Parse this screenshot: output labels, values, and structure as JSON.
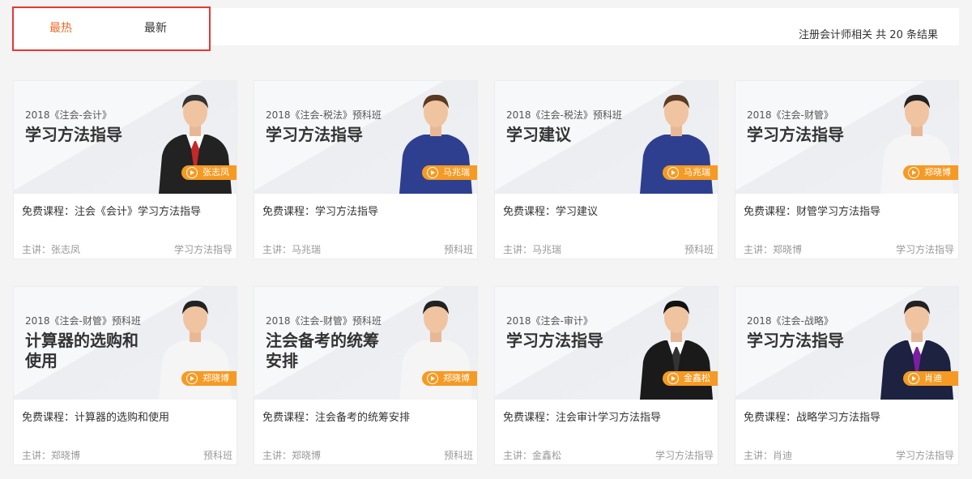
{
  "tabs": [
    {
      "label": "最热",
      "active": true
    },
    {
      "label": "最新",
      "active": false
    }
  ],
  "result_summary": "注册会计师相关 共 20 条结果",
  "colors": {
    "accent": "#f06a2a",
    "tag": "#f59a23",
    "highlight_border": "#e53935"
  },
  "courses": [
    {
      "subtitle": "2018《注会-会计》",
      "headline": "学习方法指导",
      "teacher_tag": "张志凤",
      "title": "免费课程：注会《会计》学习方法指导",
      "lecturer": "主讲：张志凤",
      "category": "学习方法指导",
      "suit": "#222",
      "shirt": "#fff",
      "tie": "#c62828",
      "hair": "#333"
    },
    {
      "subtitle": "2018《注会-税法》预科班",
      "headline": "学习方法指导",
      "teacher_tag": "马兆瑞",
      "title": "免费课程：学习方法指导",
      "lecturer": "主讲：马兆瑞",
      "category": "预科班",
      "suit": "#2e3f8f",
      "shirt": "#2e3f8f",
      "tie": "",
      "hair": "#5a3a22"
    },
    {
      "subtitle": "2018《注会-税法》预科班",
      "headline": "学习建议",
      "teacher_tag": "马兆瑞",
      "title": "免费课程：学习建议",
      "lecturer": "主讲：马兆瑞",
      "category": "预科班",
      "suit": "#2e3f8f",
      "shirt": "#2e3f8f",
      "tie": "",
      "hair": "#5a3a22"
    },
    {
      "subtitle": "2018《注会-财管》",
      "headline": "学习方法指导",
      "teacher_tag": "郑晓博",
      "title": "免费课程：财管学习方法指导",
      "lecturer": "主讲：郑晓博",
      "category": "学习方法指导",
      "suit": "#f5f5f5",
      "shirt": "#f5f5f5",
      "tie": "",
      "hair": "#222"
    },
    {
      "subtitle": "2018《注会-财管》预科班",
      "headline": "计算器的选购和使用",
      "teacher_tag": "郑晓博",
      "title": "免费课程：计算器的选购和使用",
      "lecturer": "主讲：郑晓博",
      "category": "预科班",
      "suit": "#f5f5f5",
      "shirt": "#f5f5f5",
      "tie": "",
      "hair": "#222"
    },
    {
      "subtitle": "2018《注会-财管》预科班",
      "headline": "注会备考的统筹安排",
      "teacher_tag": "郑晓博",
      "title": "免费课程：注会备考的统筹安排",
      "lecturer": "主讲：郑晓博",
      "category": "预科班",
      "suit": "#f5f5f5",
      "shirt": "#f5f5f5",
      "tie": "",
      "hair": "#222"
    },
    {
      "subtitle": "2018《注会-审计》",
      "headline": "学习方法指导",
      "teacher_tag": "金鑫松",
      "title": "免费课程：注会审计学习方法指导",
      "lecturer": "主讲：金鑫松",
      "category": "学习方法指导",
      "suit": "#1a1a1a",
      "shirt": "#fff",
      "tie": "#333",
      "hair": "#111"
    },
    {
      "subtitle": "2018《注会-战略》",
      "headline": "学习方法指导",
      "teacher_tag": "肖迪",
      "title": "免费课程：战略学习方法指导",
      "lecturer": "主讲：肖迪",
      "category": "学习方法指导",
      "suit": "#1c2240",
      "shirt": "#fff",
      "tie": "#7b1fa2",
      "hair": "#222"
    }
  ]
}
